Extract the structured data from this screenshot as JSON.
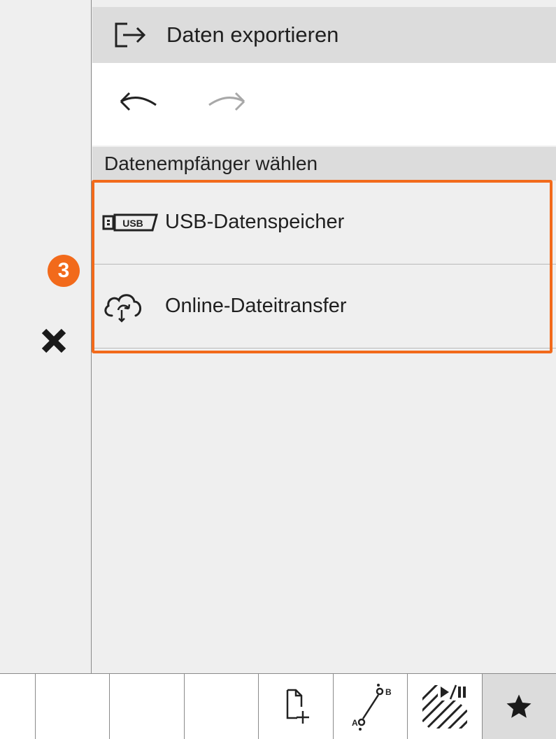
{
  "header": {
    "title": "Daten exportieren",
    "title_icon": "export-icon"
  },
  "history": {
    "undo_icon": "undo-arrow-icon",
    "redo_icon": "redo-arrow-icon",
    "redo_enabled": false
  },
  "section": {
    "title": "Datenempfänger wählen"
  },
  "recipients": [
    {
      "label": "USB-Datenspeicher",
      "icon": "usb-drive-icon",
      "icon_text": "USB"
    },
    {
      "label": "Online-Dateitransfer",
      "icon": "cloud-sync-icon"
    }
  ],
  "callout": {
    "number": "3",
    "color": "#f26a1b"
  },
  "sidebar": {
    "close_icon": "close-icon"
  },
  "toolbar": {
    "buttons": [
      {
        "icon": ""
      },
      {
        "icon": ""
      },
      {
        "icon": ""
      },
      {
        "icon": "new-document-icon"
      },
      {
        "icon": "a-to-b-line-icon",
        "label_a": "A",
        "label_b": "B"
      },
      {
        "icon": "hatch-play-pause-icon"
      },
      {
        "icon": "star-icon",
        "active": true
      }
    ]
  }
}
